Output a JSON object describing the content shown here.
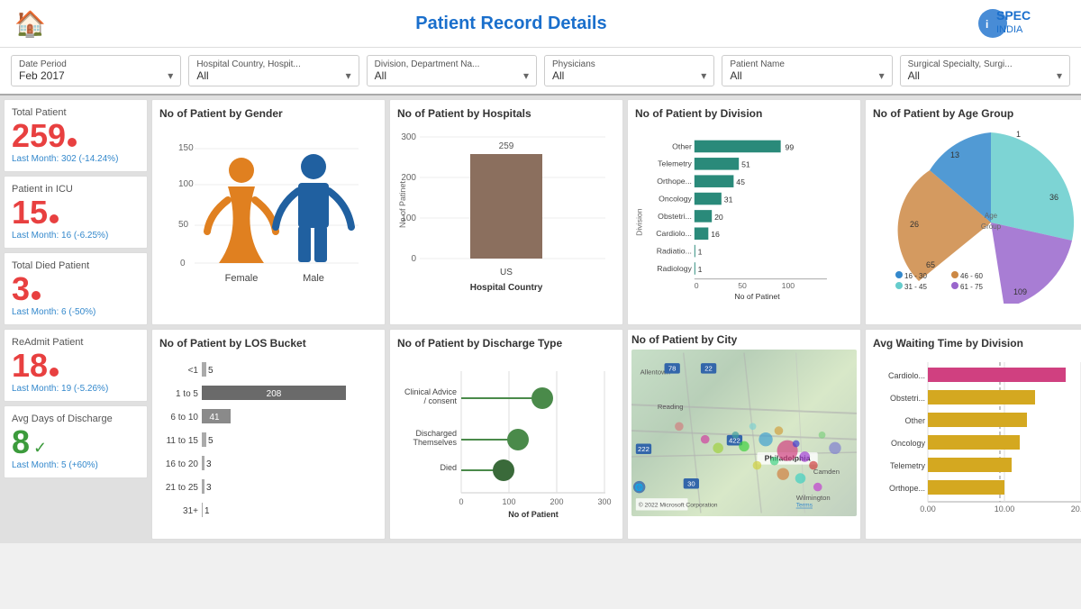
{
  "header": {
    "title": "Patient Record Details",
    "home_icon": "🏠"
  },
  "filters": [
    {
      "label": "Date Period",
      "value": "Feb 2017"
    },
    {
      "label": "Hospital Country, Hospit...",
      "value": "All"
    },
    {
      "label": "Division, Department Na...",
      "value": "All"
    },
    {
      "label": "Physicians",
      "value": "All"
    },
    {
      "label": "Patient Name",
      "value": "All"
    },
    {
      "label": "Surgical Specialty, Surgi...",
      "value": "All"
    }
  ],
  "kpis": [
    {
      "title": "Total Patient",
      "value": "259",
      "sub": "Last Month: 302 (-14.24%)"
    },
    {
      "title": "Patient in ICU",
      "value": "15",
      "sub": "Last Month: 16 (-6.25%)"
    },
    {
      "title": "Total Died Patient",
      "value": "3",
      "sub": "Last Month: 6 (-50%)"
    },
    {
      "title": "ReAdmit Patient",
      "value": "18",
      "sub": "Last Month: 19 (-5.26%)"
    },
    {
      "title": "Avg Days of Discharge",
      "value": "8",
      "sub": "Last Month: 5 (+60%)"
    }
  ],
  "gender_chart": {
    "title": "No of Patient by Gender",
    "y_ticks": [
      "150",
      "100",
      "50",
      "0"
    ],
    "labels": [
      "Female",
      "Male"
    ]
  },
  "hospital_chart": {
    "title": "No of Patient by Hospitals",
    "y_ticks": [
      "300",
      "200",
      "100",
      "0"
    ],
    "value": 259,
    "label": "US",
    "x_label": "Hospital Country",
    "y_label": "No of Patinet"
  },
  "division_chart": {
    "title": "No of Patient by Division",
    "x_label": "No of Patinet",
    "y_label": "Division",
    "max": 100,
    "rows": [
      {
        "label": "Other",
        "value": 99
      },
      {
        "label": "Telemetry",
        "value": 51
      },
      {
        "label": "Orthope...",
        "value": 45
      },
      {
        "label": "Oncology",
        "value": 31
      },
      {
        "label": "Obstetri...",
        "value": 20
      },
      {
        "label": "Cardiolo...",
        "value": 16
      },
      {
        "label": "Radiatio...",
        "value": 1
      },
      {
        "label": "Radiology",
        "value": 1
      }
    ]
  },
  "age_chart": {
    "title": "No of Patient by Age Group",
    "segments": [
      {
        "label": "16-30",
        "value": 109,
        "color": "#3388cc"
      },
      {
        "label": "31-45",
        "value": 65,
        "color": "#66cccc"
      },
      {
        "label": "46-60",
        "value": 26,
        "color": "#cc8844"
      },
      {
        "label": "61-75",
        "value": 36,
        "color": "#9966cc"
      }
    ],
    "inner_values": [
      "13",
      "1",
      "36",
      "26",
      "65",
      "109"
    ]
  },
  "los_chart": {
    "title": "No of Patient by LOS Bucket",
    "max": 208,
    "rows": [
      {
        "label": "<1",
        "value": 5
      },
      {
        "label": "1 to 5",
        "value": 208,
        "highlight": true
      },
      {
        "label": "6 to 10",
        "value": 41
      },
      {
        "label": "11 to 15",
        "value": 5
      },
      {
        "label": "16 to 20",
        "value": 3
      },
      {
        "label": "21 to 25",
        "value": 3
      },
      {
        "label": "31+",
        "value": 1
      }
    ]
  },
  "discharge_chart": {
    "title": "No of Patient by Discharge Type",
    "x_label": "No of Patient",
    "x_ticks": [
      "0",
      "100",
      "200",
      "300"
    ],
    "max": 300,
    "rows": [
      {
        "label": "Clinical Advice / consent",
        "value": 180
      },
      {
        "label": "Discharged Themselves",
        "value": 120
      },
      {
        "label": "Died",
        "value": 90
      }
    ]
  },
  "map_chart": {
    "title": "No of Patient by City",
    "copyright": "© 2022 Microsoft Corporation",
    "terms": "Terms"
  },
  "waiting_chart": {
    "title": "Avg Waiting Time by Division",
    "x_ticks": [
      "0.00",
      "10.00",
      "20.00"
    ],
    "max": 20,
    "rows": [
      {
        "label": "Cardiolo...",
        "value": 18,
        "type": "pink"
      },
      {
        "label": "Obstetri...",
        "value": 14,
        "type": "yellow"
      },
      {
        "label": "Other",
        "value": 13,
        "type": "yellow"
      },
      {
        "label": "Oncology",
        "value": 12,
        "type": "yellow"
      },
      {
        "label": "Telemetry",
        "value": 11,
        "type": "yellow"
      },
      {
        "label": "Orthope...",
        "value": 10,
        "type": "yellow"
      }
    ]
  }
}
